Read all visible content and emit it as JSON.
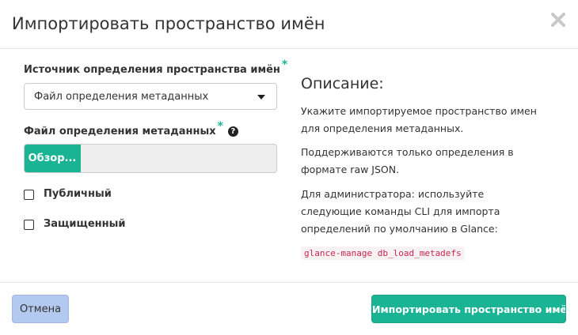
{
  "dialog": {
    "title": "Импортировать пространство имён",
    "close_icon": "close-icon"
  },
  "form": {
    "source": {
      "label": "Источник определения пространства имён",
      "required_mark": "*",
      "selected": "Файл определения метаданных"
    },
    "file": {
      "label": "Файл определения метаданных",
      "required_mark": "*",
      "help_icon": "question-circle-icon",
      "help_glyph": "?",
      "browse_label": "Обзор...",
      "file_name": ""
    },
    "public": {
      "label": "Публичный",
      "checked": false
    },
    "protected": {
      "label": "Защищенный",
      "checked": false
    }
  },
  "description": {
    "title": "Описание:",
    "paragraphs": [
      "Укажите импортируемое пространство имен для определения метаданных.",
      "Поддерживаются только определения в формате raw JSON.",
      "Для администратора: используйте следующие команды CLI для импорта определений по умолчанию в Glance:"
    ],
    "command": "glance-manage db_load_metadefs"
  },
  "footer": {
    "cancel_label": "Отмена",
    "submit_label": "Импортировать пространство имён"
  },
  "colors": {
    "primary": "#1ab394",
    "cancel": "#b4c9f0",
    "code_text": "#c7254e",
    "code_bg": "#f9f2f4"
  }
}
